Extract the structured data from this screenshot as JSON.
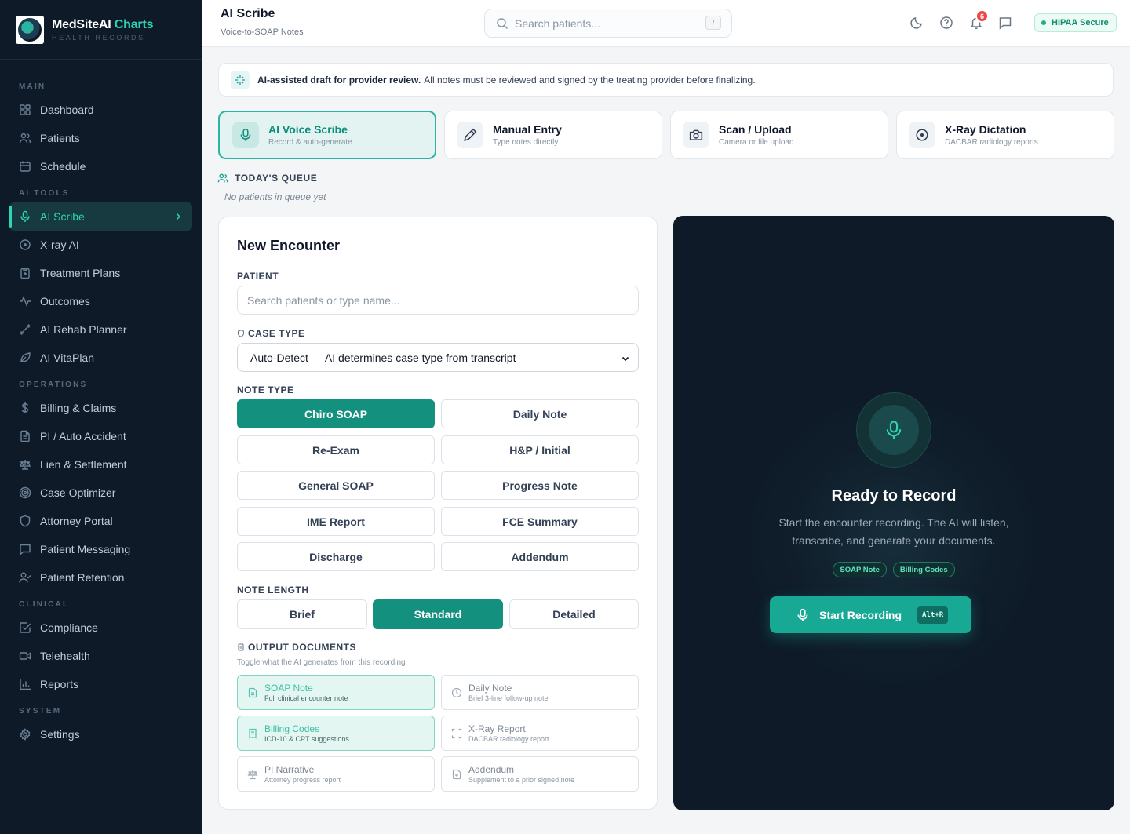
{
  "brand": {
    "name_main": "MedSiteAI",
    "name_accent": " Charts",
    "subtitle": "HEALTH RECORDS",
    "logo_text": "MedSiteAI"
  },
  "sidebar": {
    "sections": [
      {
        "title": "MAIN",
        "items": [
          {
            "label": "Dashboard",
            "icon": "grid-icon"
          },
          {
            "label": "Patients",
            "icon": "users-icon"
          },
          {
            "label": "Schedule",
            "icon": "calendar-icon"
          }
        ]
      },
      {
        "title": "AI TOOLS",
        "items": [
          {
            "label": "AI Scribe",
            "icon": "mic-icon",
            "active": true
          },
          {
            "label": "X-ray AI",
            "icon": "scan-circle-icon"
          },
          {
            "label": "Treatment Plans",
            "icon": "clipboard-plus-icon"
          },
          {
            "label": "Outcomes",
            "icon": "activity-icon"
          },
          {
            "label": "AI Rehab Planner",
            "icon": "dumbbell-icon"
          },
          {
            "label": "AI VitaPlan",
            "icon": "leaf-icon"
          }
        ]
      },
      {
        "title": "OPERATIONS",
        "items": [
          {
            "label": "Billing & Claims",
            "icon": "dollar-icon"
          },
          {
            "label": "PI / Auto Accident",
            "icon": "file-text-icon"
          },
          {
            "label": "Lien & Settlement",
            "icon": "scale-icon"
          },
          {
            "label": "Case Optimizer",
            "icon": "target-icon"
          },
          {
            "label": "Attorney Portal",
            "icon": "shield-icon"
          },
          {
            "label": "Patient Messaging",
            "icon": "message-icon"
          },
          {
            "label": "Patient Retention",
            "icon": "user-check-icon"
          }
        ]
      },
      {
        "title": "CLINICAL",
        "items": [
          {
            "label": "Compliance",
            "icon": "check-square-icon"
          },
          {
            "label": "Telehealth",
            "icon": "video-icon"
          },
          {
            "label": "Reports",
            "icon": "bar-chart-icon"
          }
        ]
      },
      {
        "title": "SYSTEM",
        "items": [
          {
            "label": "Settings",
            "icon": "gear-icon"
          }
        ]
      }
    ]
  },
  "header": {
    "title": "AI Scribe",
    "subtitle": "Voice-to-SOAP Notes",
    "search_placeholder": "Search patients...",
    "search_shortcut": "/",
    "notification_count": "6",
    "hipaa_label": "HIPAA Secure"
  },
  "banner": {
    "bold": "AI-assisted draft for provider review.",
    "text": "All notes must be reviewed and signed by the treating provider before finalizing."
  },
  "modes": [
    {
      "title": "AI Voice Scribe",
      "sub": "Record & auto-generate",
      "icon": "mic-icon",
      "active": true
    },
    {
      "title": "Manual Entry",
      "sub": "Type notes directly",
      "icon": "pencil-icon"
    },
    {
      "title": "Scan / Upload",
      "sub": "Camera or file upload",
      "icon": "camera-icon"
    },
    {
      "title": "X-Ray Dictation",
      "sub": "DACBAR radiology reports",
      "icon": "scan-circle-icon"
    }
  ],
  "queue": {
    "title": "TODAY'S QUEUE",
    "empty": "No patients in queue yet"
  },
  "encounter": {
    "title": "New Encounter",
    "patient_label": "PATIENT",
    "patient_placeholder": "Search patients or type name...",
    "case_type_label": "CASE TYPE",
    "case_type_value": "Auto-Detect — AI determines case type from transcript",
    "note_type_label": "NOTE TYPE",
    "note_types": [
      "Chiro SOAP",
      "Daily Note",
      "Re-Exam",
      "H&P / Initial",
      "General SOAP",
      "Progress Note",
      "IME Report",
      "FCE Summary",
      "Discharge",
      "Addendum"
    ],
    "note_type_selected": "Chiro SOAP",
    "note_length_label": "NOTE LENGTH",
    "note_lengths": [
      "Brief",
      "Standard",
      "Detailed"
    ],
    "note_length_selected": "Standard",
    "output_label": "OUTPUT DOCUMENTS",
    "output_help": "Toggle what the AI generates from this recording",
    "outputs": [
      {
        "title": "SOAP Note",
        "sub": "Full clinical encounter note",
        "on": true,
        "icon": "file-icon"
      },
      {
        "title": "Daily Note",
        "sub": "Brief 3-line follow-up note",
        "on": false,
        "icon": "clock-icon"
      },
      {
        "title": "Billing Codes",
        "sub": "ICD-10 & CPT suggestions",
        "on": true,
        "icon": "receipt-icon"
      },
      {
        "title": "X-Ray Report",
        "sub": "DACBAR radiology report",
        "on": false,
        "icon": "scan-icon"
      },
      {
        "title": "PI Narrative",
        "sub": "Attorney progress report",
        "on": false,
        "icon": "scale-icon"
      },
      {
        "title": "Addendum",
        "sub": "Supplement to a prior signed note",
        "on": false,
        "icon": "file-plus-icon"
      }
    ]
  },
  "recorder": {
    "title": "Ready to Record",
    "description": "Start the encounter recording. The AI will listen, transcribe, and generate your documents.",
    "chips": [
      "SOAP Note",
      "Billing Codes"
    ],
    "start_label": "Start Recording",
    "shortcut": "Alt+R"
  },
  "colors": {
    "accent": "#14907e",
    "accent_bright": "#2fd3b5",
    "sidebar_bg": "#0e1a28",
    "notification": "#ef4444"
  }
}
